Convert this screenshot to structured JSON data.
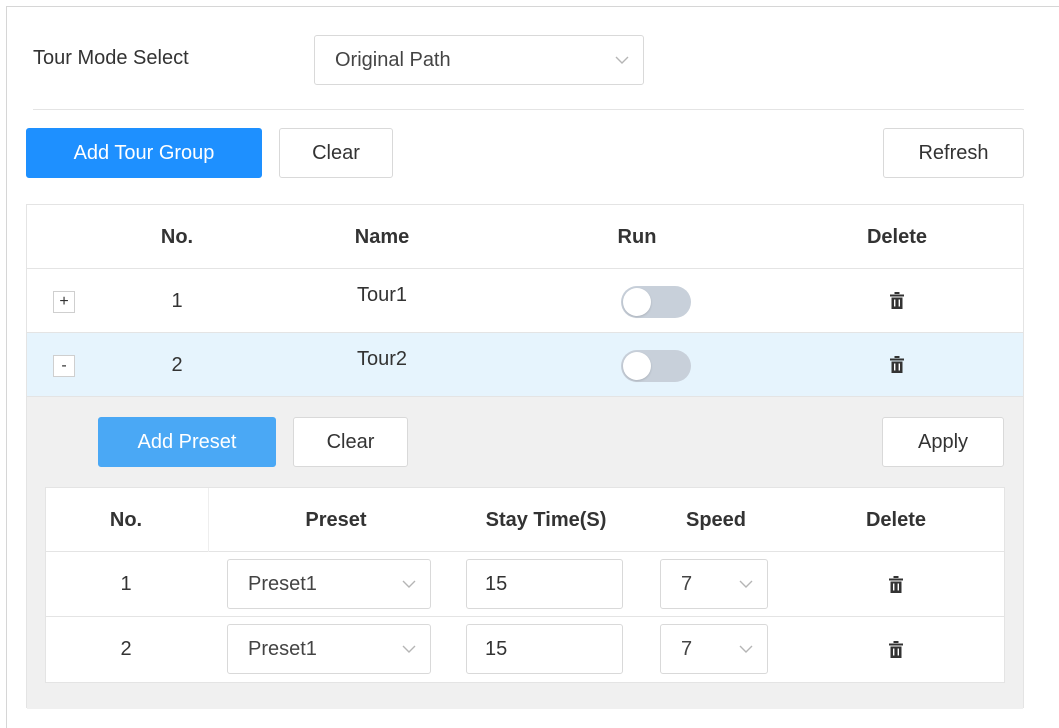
{
  "tour_mode": {
    "label": "Tour Mode Select",
    "value": "Original Path"
  },
  "toolbar": {
    "add_tour_group": "Add Tour Group",
    "clear": "Clear",
    "refresh": "Refresh"
  },
  "tour_table": {
    "headers": {
      "no": "No.",
      "name": "Name",
      "run": "Run",
      "delete": "Delete"
    },
    "rows": [
      {
        "expander": "+",
        "no": "1",
        "name": "Tour1",
        "run": false
      },
      {
        "expander": "-",
        "no": "2",
        "name": "Tour2",
        "run": false
      }
    ]
  },
  "preset_toolbar": {
    "add_preset": "Add Preset",
    "clear": "Clear",
    "apply": "Apply"
  },
  "preset_table": {
    "headers": {
      "no": "No.",
      "preset": "Preset",
      "stay_time": "Stay Time(S)",
      "speed": "Speed",
      "delete": "Delete"
    },
    "rows": [
      {
        "no": "1",
        "preset": "Preset1",
        "stay_time": "15",
        "speed": "7"
      },
      {
        "no": "2",
        "preset": "Preset1",
        "stay_time": "15",
        "speed": "7"
      }
    ]
  },
  "colors": {
    "primary": "#1e90ff",
    "primary_light": "#4aa8f5",
    "row_highlight": "#e6f4fd",
    "subpanel_bg": "#f0f0f0",
    "toggle_off": "#c8d0da"
  },
  "icons": {
    "dropdown": "chevron-down-icon",
    "delete": "trash-icon",
    "expand": "plus-box",
    "collapse": "minus-box"
  }
}
